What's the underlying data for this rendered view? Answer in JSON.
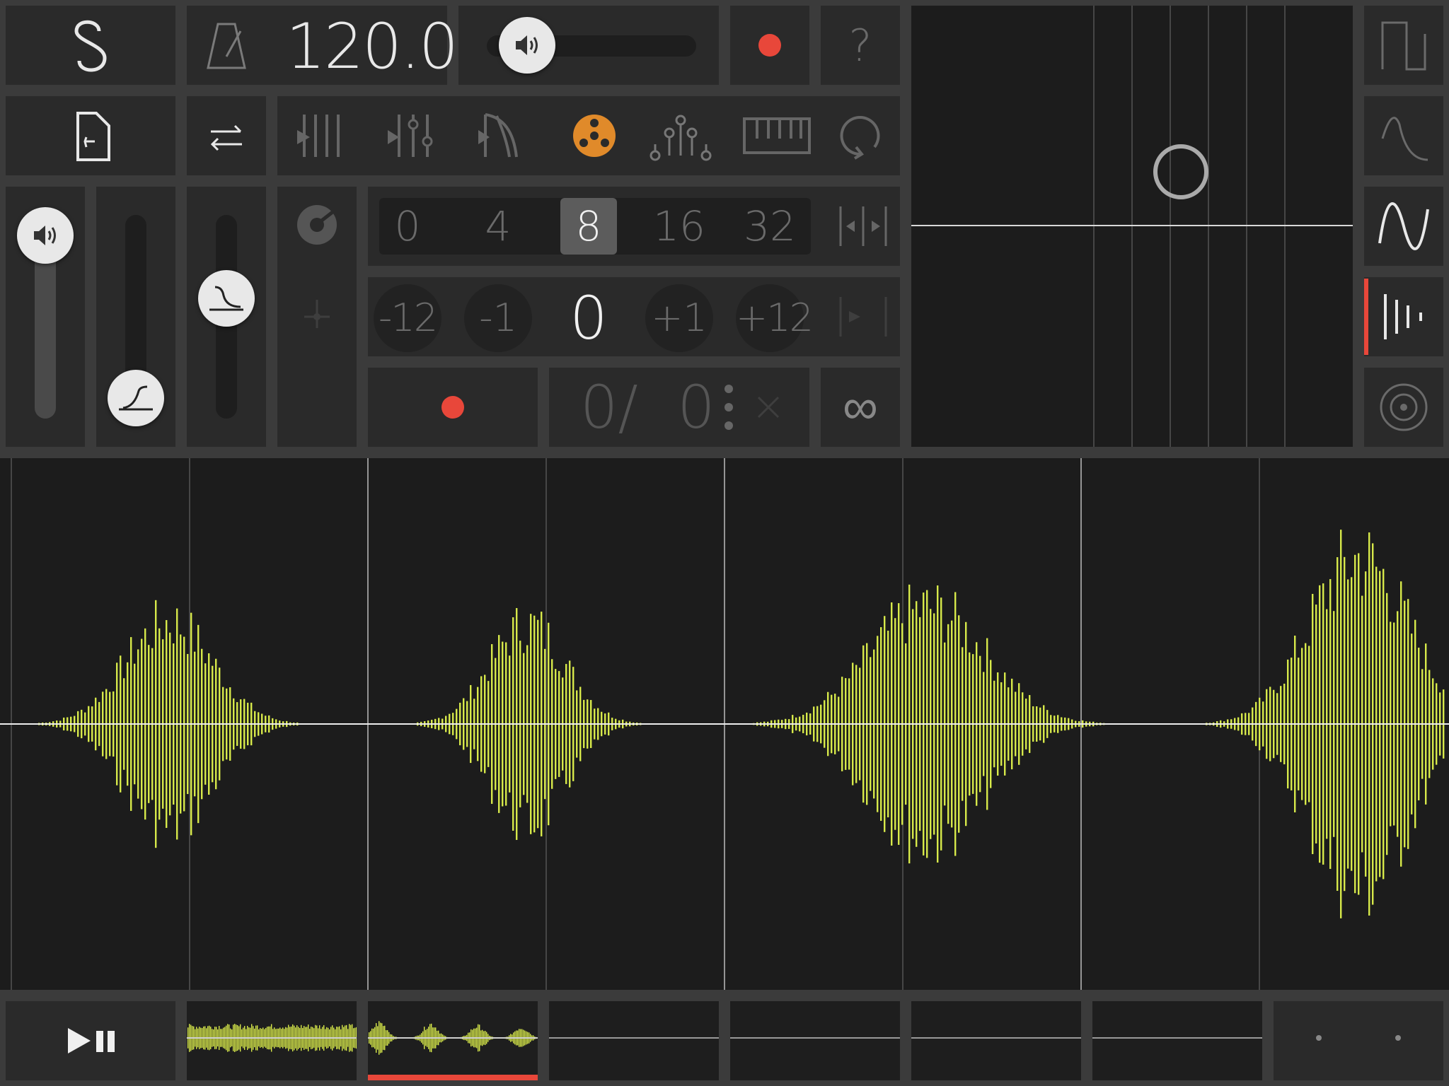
{
  "header": {
    "tempo_value": "120.0",
    "help_label": "?"
  },
  "quantize": {
    "options": [
      "0",
      "4",
      "8",
      "16",
      "32"
    ],
    "selected": "8"
  },
  "transpose": {
    "options": [
      "-12",
      "-1",
      "0",
      "+1",
      "+12"
    ],
    "selected": "0"
  },
  "loop": {
    "position_label": "0/",
    "count_label": "0",
    "infinite_label": "∞"
  },
  "colors": {
    "background": "#3b3b3b",
    "panel": "#2a2a2a",
    "waveform": "#d7e94a",
    "record": "#e8473a",
    "accent_orange": "#e08a2a",
    "selected_cell": "#5c5c5c"
  },
  "toolbar": {
    "icons": [
      "sequencer-icon",
      "mixer-icon",
      "effects-icon",
      "tape-reel-icon",
      "modulation-icon",
      "keyboard-icon",
      "loop-icon"
    ],
    "active": "tape-reel-icon"
  },
  "side_panel": {
    "icons": [
      "square-wave-icon",
      "envelope-icon",
      "sine-wave-icon",
      "sample-icon",
      "target-icon"
    ],
    "active": "sample-icon"
  },
  "volume": {
    "level": 0.95
  },
  "attack": {
    "level": 0.05
  },
  "release": {
    "level": 0.6
  },
  "master_volume": {
    "level": 0.05
  },
  "transport": {
    "play_pause_icon": "play-pause-icon"
  }
}
